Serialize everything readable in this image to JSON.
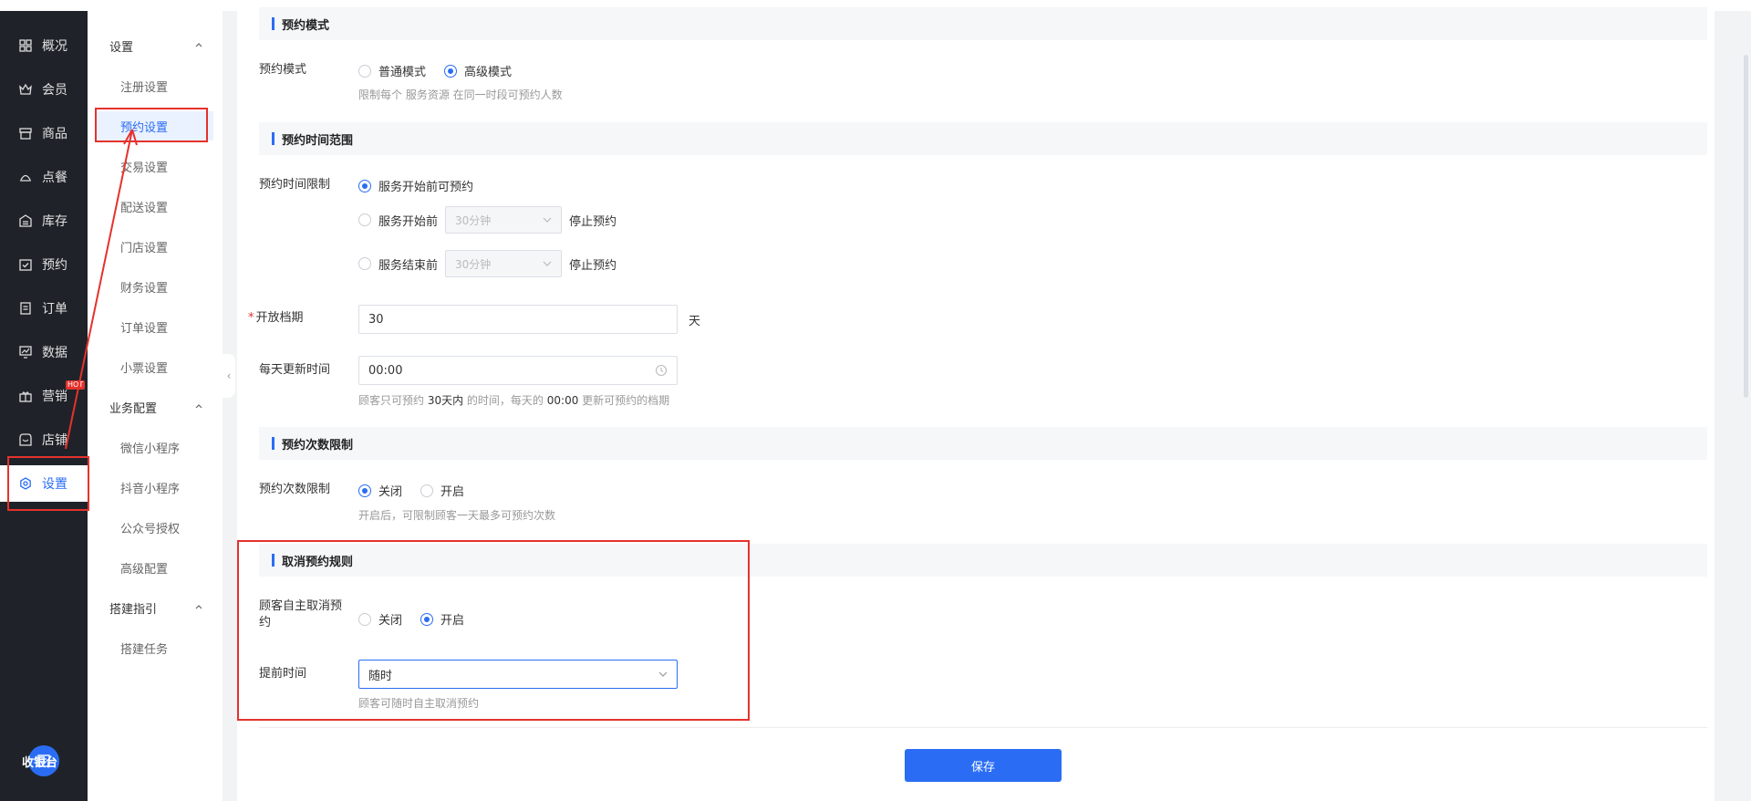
{
  "nav": {
    "items": [
      {
        "label": "概况",
        "icon": "grid-icon"
      },
      {
        "label": "会员",
        "icon": "crown-icon"
      },
      {
        "label": "商品",
        "icon": "shop-icon"
      },
      {
        "label": "点餐",
        "icon": "dish-icon"
      },
      {
        "label": "库存",
        "icon": "inventory-icon"
      },
      {
        "label": "预约",
        "icon": "calendar-check-icon"
      },
      {
        "label": "订单",
        "icon": "order-icon"
      },
      {
        "label": "数据",
        "icon": "chart-icon"
      },
      {
        "label": "营销",
        "icon": "gift-icon",
        "badge": "HOT"
      },
      {
        "label": "店铺",
        "icon": "store-icon"
      },
      {
        "label": "设置",
        "icon": "gear-icon"
      }
    ],
    "cashier_label": "收银台"
  },
  "submenu": {
    "groups": [
      {
        "label": "设置",
        "items": [
          "注册设置",
          "预约设置",
          "交易设置",
          "配送设置",
          "门店设置",
          "财务设置",
          "订单设置",
          "小票设置"
        ]
      },
      {
        "label": "业务配置",
        "items": [
          "微信小程序",
          "抖音小程序",
          "公众号授权",
          "高级配置"
        ]
      },
      {
        "label": "搭建指引",
        "items": [
          "搭建任务"
        ]
      }
    ],
    "active_item": "预约设置"
  },
  "sections": {
    "mode": {
      "title": "预约模式",
      "label": "预约模式",
      "options": [
        "普通模式",
        "高级模式"
      ],
      "selected": "高级模式",
      "hint": "限制每个 服务资源 在同一时段可预约人数"
    },
    "range": {
      "title": "预约时间范围",
      "limit_label": "预约时间限制",
      "opt1": "服务开始前可预约",
      "opt2_prefix": "服务开始前",
      "opt2_select": "30分钟",
      "opt2_suffix": "停止预约",
      "opt3_prefix": "服务结束前",
      "opt3_select": "30分钟",
      "opt3_suffix": "停止预约",
      "open_label": "开放档期",
      "open_value": "30",
      "open_unit": "天",
      "update_label": "每天更新时间",
      "update_value": "00:00",
      "hint_pre": "顾客只可预约 ",
      "hint_days": "30天内",
      "hint_mid": " 的时间，每天的 ",
      "hint_time": "00:00",
      "hint_post": " 更新可预约的档期"
    },
    "count": {
      "title": "预约次数限制",
      "label": "预约次数限制",
      "options": [
        "关闭",
        "开启"
      ],
      "selected": "关闭",
      "hint": "开启后，可限制顾客一天最多可预约次数"
    },
    "cancel": {
      "title": "取消预约规则",
      "self_label": "顾客自主取消预约",
      "options": [
        "关闭",
        "开启"
      ],
      "selected": "开启",
      "advance_label": "提前时间",
      "advance_value": "随时",
      "hint": "顾客可随时自主取消预约"
    }
  },
  "footer": {
    "save_label": "保存"
  },
  "colors": {
    "accent": "#2a6df4",
    "nav_bg": "#1f2329",
    "annotation": "#e5322d"
  }
}
